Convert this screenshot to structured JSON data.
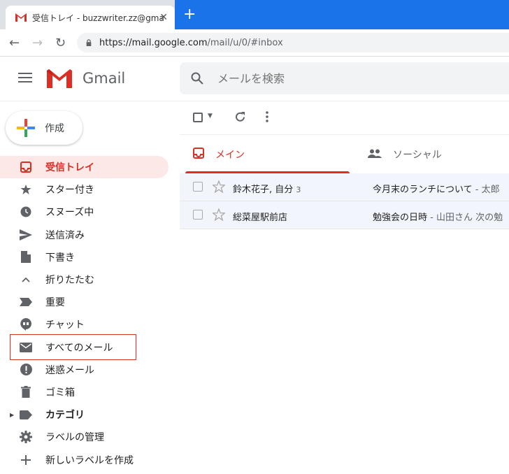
{
  "browser": {
    "tab_title": "受信トレイ - buzzwriter.zz@gmail.c",
    "url_host": "https://mail.google.com",
    "url_path": "/mail/u/0/#inbox"
  },
  "header": {
    "app_name": "Gmail",
    "search_placeholder": "メールを検索"
  },
  "compose": {
    "label": "作成"
  },
  "sidebar": {
    "items": [
      {
        "label": "受信トレイ"
      },
      {
        "label": "スター付き"
      },
      {
        "label": "スヌーズ中"
      },
      {
        "label": "送信済み"
      },
      {
        "label": "下書き"
      },
      {
        "label": "折りたたむ"
      },
      {
        "label": "重要"
      },
      {
        "label": "チャット"
      },
      {
        "label": "すべてのメール"
      },
      {
        "label": "迷惑メール"
      },
      {
        "label": "ゴミ箱"
      },
      {
        "label": "カテゴリ"
      },
      {
        "label": "ラベルの管理"
      },
      {
        "label": "新しいラベルを作成"
      }
    ]
  },
  "tabs": {
    "primary": "メイン",
    "social": "ソーシャル"
  },
  "emails": [
    {
      "sender": "鈴木花子, 自分",
      "count": "3",
      "subject": "今月末のランチについて",
      "snippet": " - 太郎"
    },
    {
      "sender": "総菜屋駅前店",
      "count": "",
      "subject": "勉強会の日時",
      "snippet": " - 山田さん 次の勉"
    }
  ],
  "colors": {
    "accent": "#d93025",
    "chrome_blue": "#1a73e8"
  }
}
